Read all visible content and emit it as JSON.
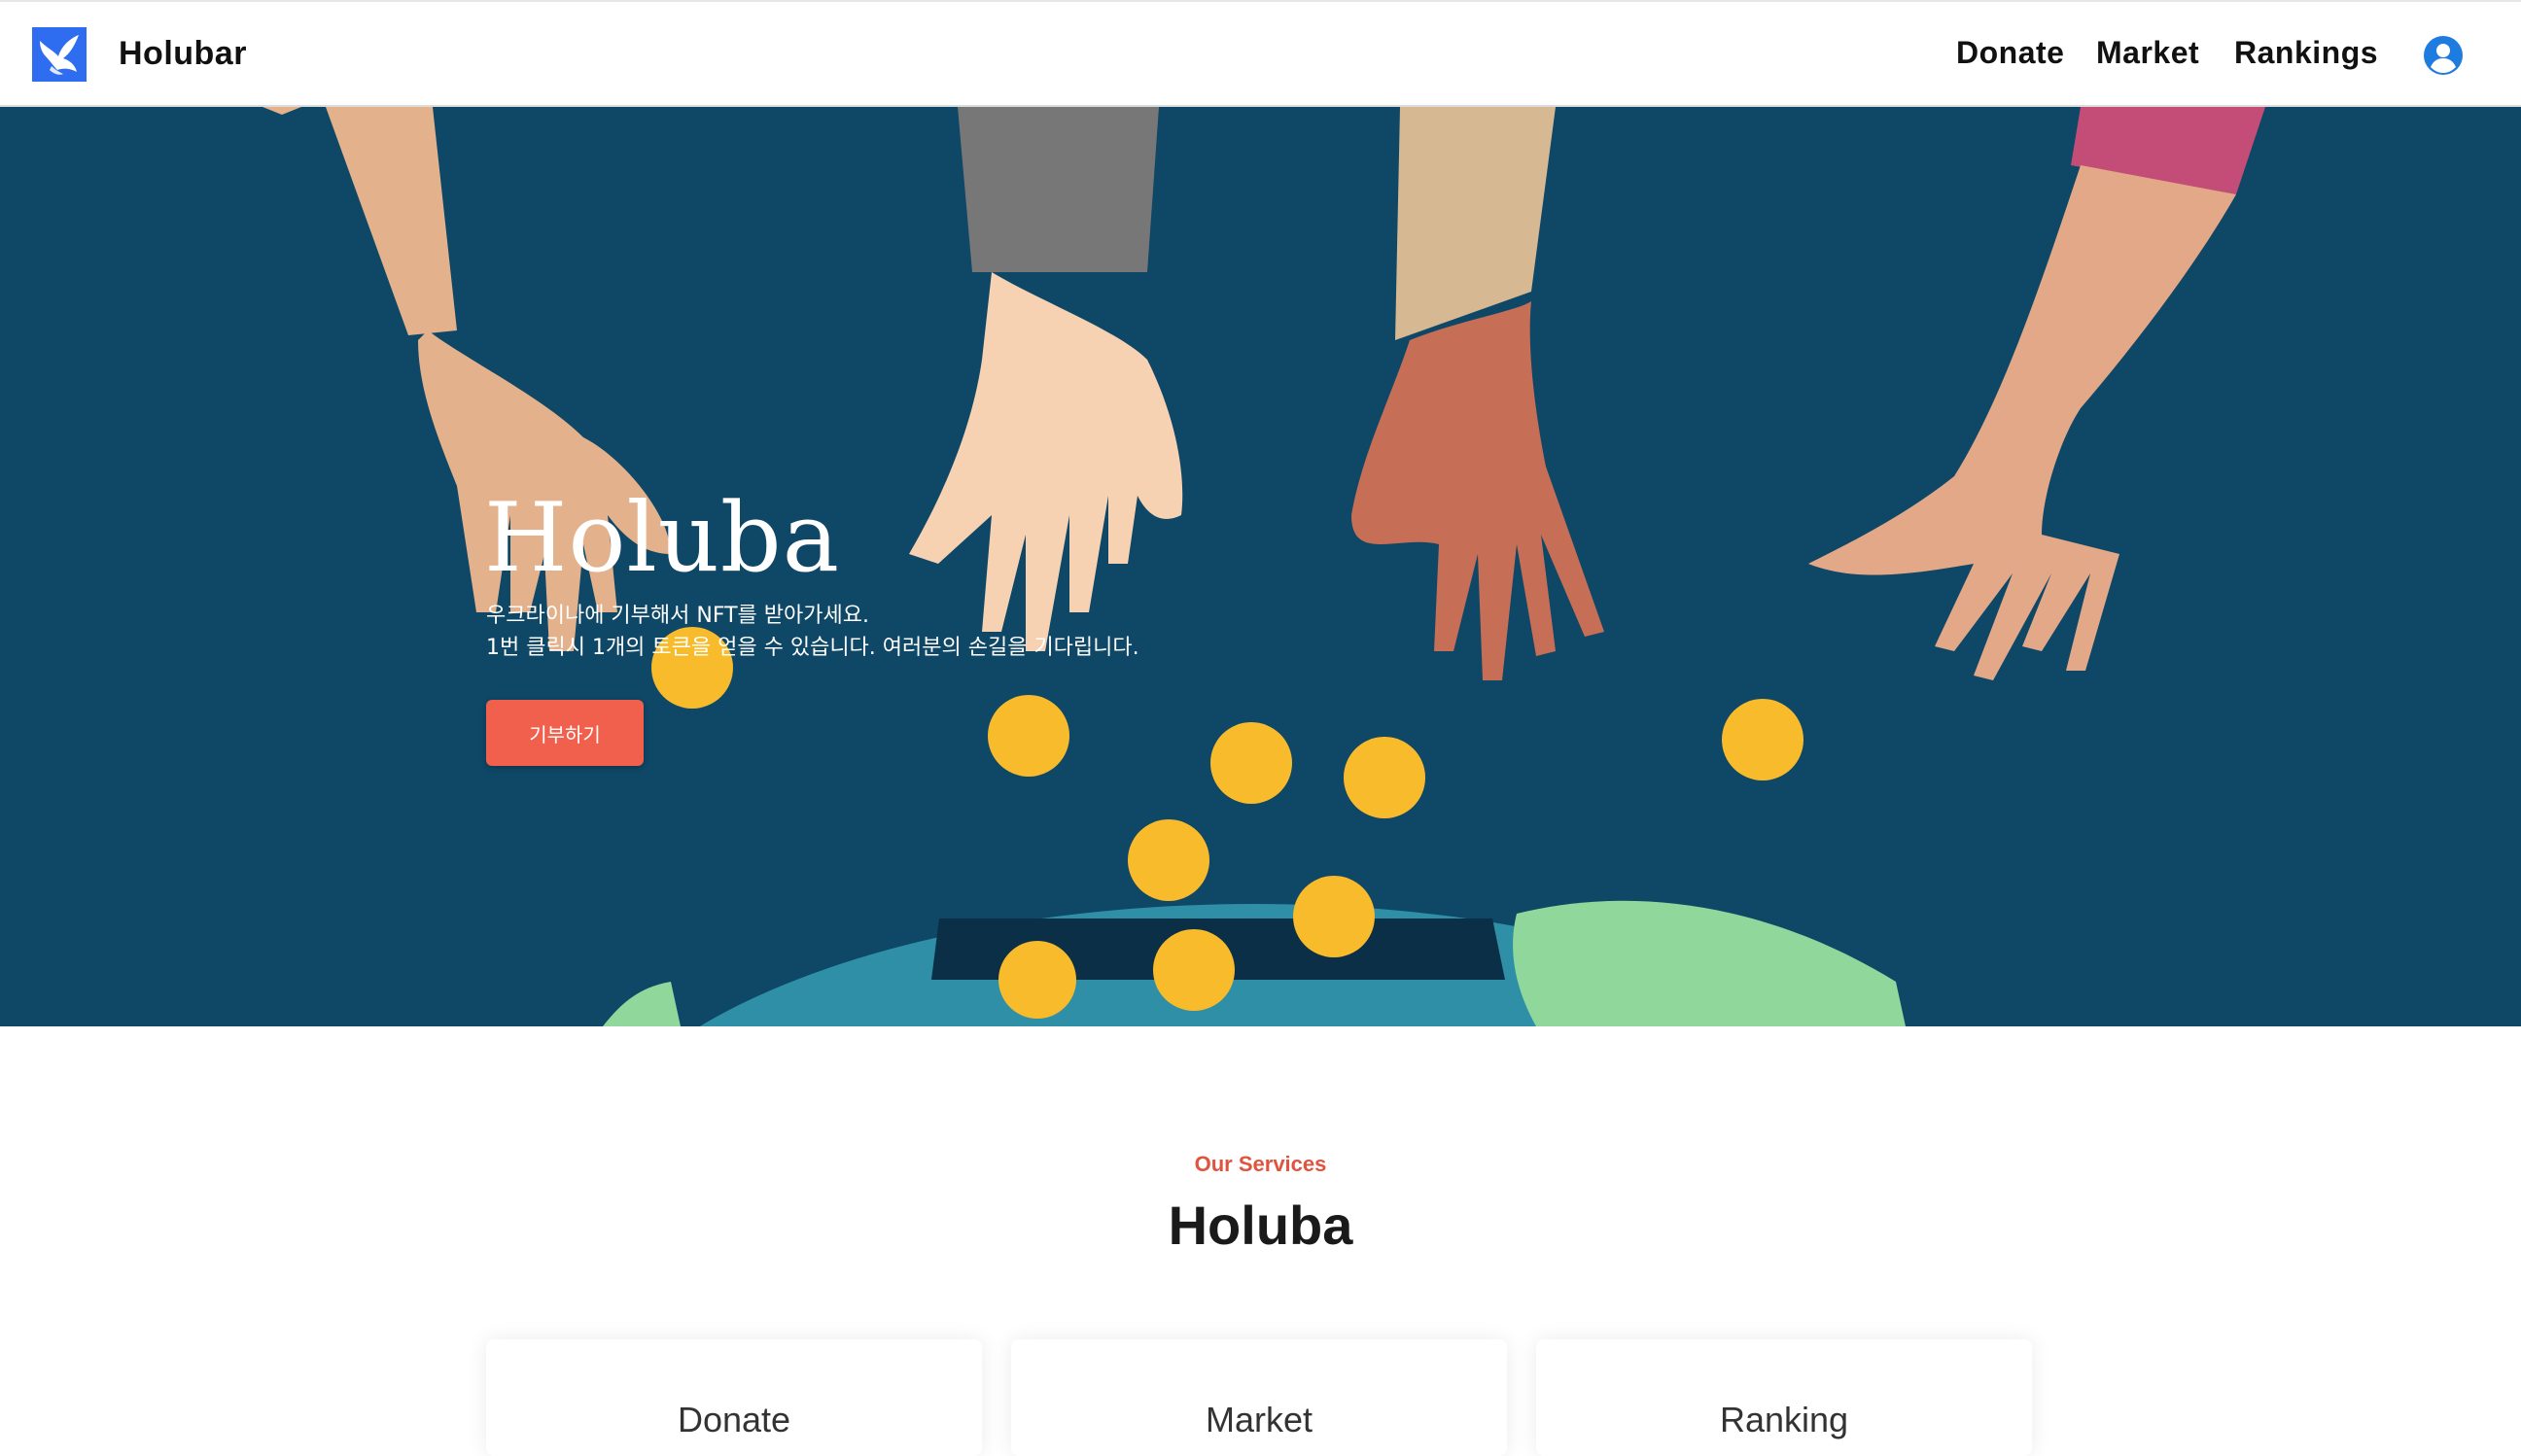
{
  "nav": {
    "brand": "Holubar",
    "items": [
      {
        "label": "Donate"
      },
      {
        "label": "Market"
      },
      {
        "label": "Rankings"
      }
    ]
  },
  "hero": {
    "title": "Holuba",
    "line1": "우크라이나에 기부해서 NFT를 받아가세요.",
    "line2": "1번 클릭시 1개의 토큰을 얻을 수 있습니다. 여러분의 손길을 기다립니다.",
    "button": "기부하기"
  },
  "services": {
    "subtitle": "Our Services",
    "title": "Holuba",
    "cards": [
      {
        "title": "Donate"
      },
      {
        "title": "Market"
      },
      {
        "title": "Ranking"
      }
    ]
  },
  "colors": {
    "hero_bg": "#0f4766",
    "accent": "#f0604c",
    "coin": "#f7bb2c",
    "logo_bg": "#2f6df0",
    "user_icon": "#1e7be0"
  },
  "icons": {
    "logo": "dove-logo-icon",
    "user": "user-circle-icon"
  }
}
